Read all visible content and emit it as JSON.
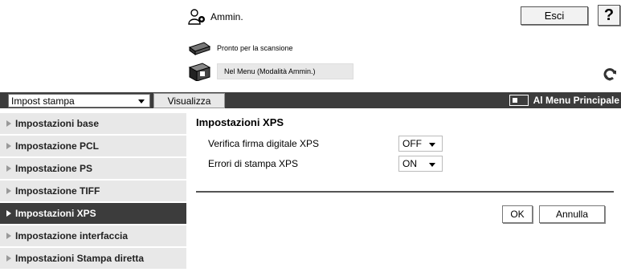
{
  "header": {
    "user_label": "Ammin.",
    "logout_label": "Esci",
    "help_label": "?"
  },
  "status": {
    "scan_text": "Pronto per la scansione",
    "menu_text": "Nel Menu (Modalità Ammin.)"
  },
  "menubar": {
    "category_selected": "Impost stampa",
    "view_label": "Visualizza",
    "main_menu_label": "Al Menu Principale"
  },
  "sidebar": {
    "items": [
      {
        "label": "Impostazioni base"
      },
      {
        "label": "Impostazione PCL"
      },
      {
        "label": "Impostazione PS"
      },
      {
        "label": "Impostazione TIFF"
      },
      {
        "label": "Impostazioni XPS"
      },
      {
        "label": "Impostazione interfaccia"
      },
      {
        "label": "Impostazioni Stampa diretta"
      }
    ],
    "active_index": 4
  },
  "content": {
    "title": "Impostazioni XPS",
    "settings": [
      {
        "label": "Verifica firma digitale XPS",
        "value": "OFF"
      },
      {
        "label": "Errori di stampa XPS",
        "value": "ON"
      }
    ],
    "ok_label": "OK",
    "cancel_label": "Annulla"
  },
  "colors": {
    "menubar_bg": "#3c3c3c",
    "sidebar_bg": "#e8e8e8"
  }
}
